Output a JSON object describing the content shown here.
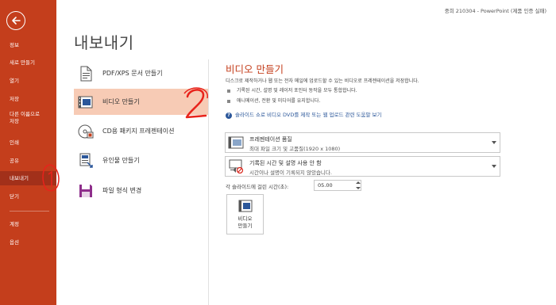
{
  "window_title": "중희 210304  -  PowerPoint (제품 인증 실패)",
  "sidebar": {
    "back_icon": "back-arrow-icon",
    "items": [
      {
        "label": "정보"
      },
      {
        "label": "새로 만들기"
      },
      {
        "label": "열기"
      },
      {
        "label": "저장"
      },
      {
        "label": "다른 이름으로\n저장"
      },
      {
        "label": "인쇄"
      },
      {
        "label": "공유"
      },
      {
        "label": "내보내기",
        "active": true
      },
      {
        "label": "닫기"
      },
      {
        "label": "계정"
      },
      {
        "label": "옵션"
      }
    ]
  },
  "page_title": "내보내기",
  "export_options": [
    {
      "label": "PDF/XPS 문서 만들기",
      "icon": "pdf-document-icon"
    },
    {
      "label": "비디오 만들기",
      "icon": "video-icon",
      "selected": true
    },
    {
      "label": "CD용 패키지 프레젠테이션",
      "icon": "cd-package-icon"
    },
    {
      "label": "유인물 만들기",
      "icon": "handouts-icon"
    },
    {
      "label": "파일 형식 변경",
      "icon": "change-file-type-icon"
    }
  ],
  "video": {
    "title": "비디오 만들기",
    "description": "디스크로 제작하거나 웹 또는 전자 메일에 업로드할 수 있는 비디오로 프레젠테이션을 저장합니다.",
    "bullets": [
      "기록된 시간, 설명 및 레이저 포인터 동작을 모두 통합합니다.",
      "애니메이션, 전환 및 미디어를 유지합니다."
    ],
    "help_link": "슬라이드 쇼로 비디오 DVD를 제작 또는 웹 업로드 관련 도움말 보기",
    "quality": {
      "title": "프레젠테이션 품질",
      "subtitle": "최대 파일 크기 및 고품질(1920 x 1080)"
    },
    "timings": {
      "title": "기록된 시간 및 설명 사용 안 함",
      "subtitle": "시간이나 설명이 기록되지 않았습니다."
    },
    "seconds_label": "각 슬라이드에 걸린 시간(초):",
    "seconds_value": "05.00",
    "create_button": "비디오\n만들기"
  },
  "annotations": [
    "1",
    "2"
  ],
  "colors": {
    "accent": "#c43e1c",
    "selected_bg": "#f7cbb5",
    "link": "#2b579a",
    "annotation": "#e8231b"
  }
}
